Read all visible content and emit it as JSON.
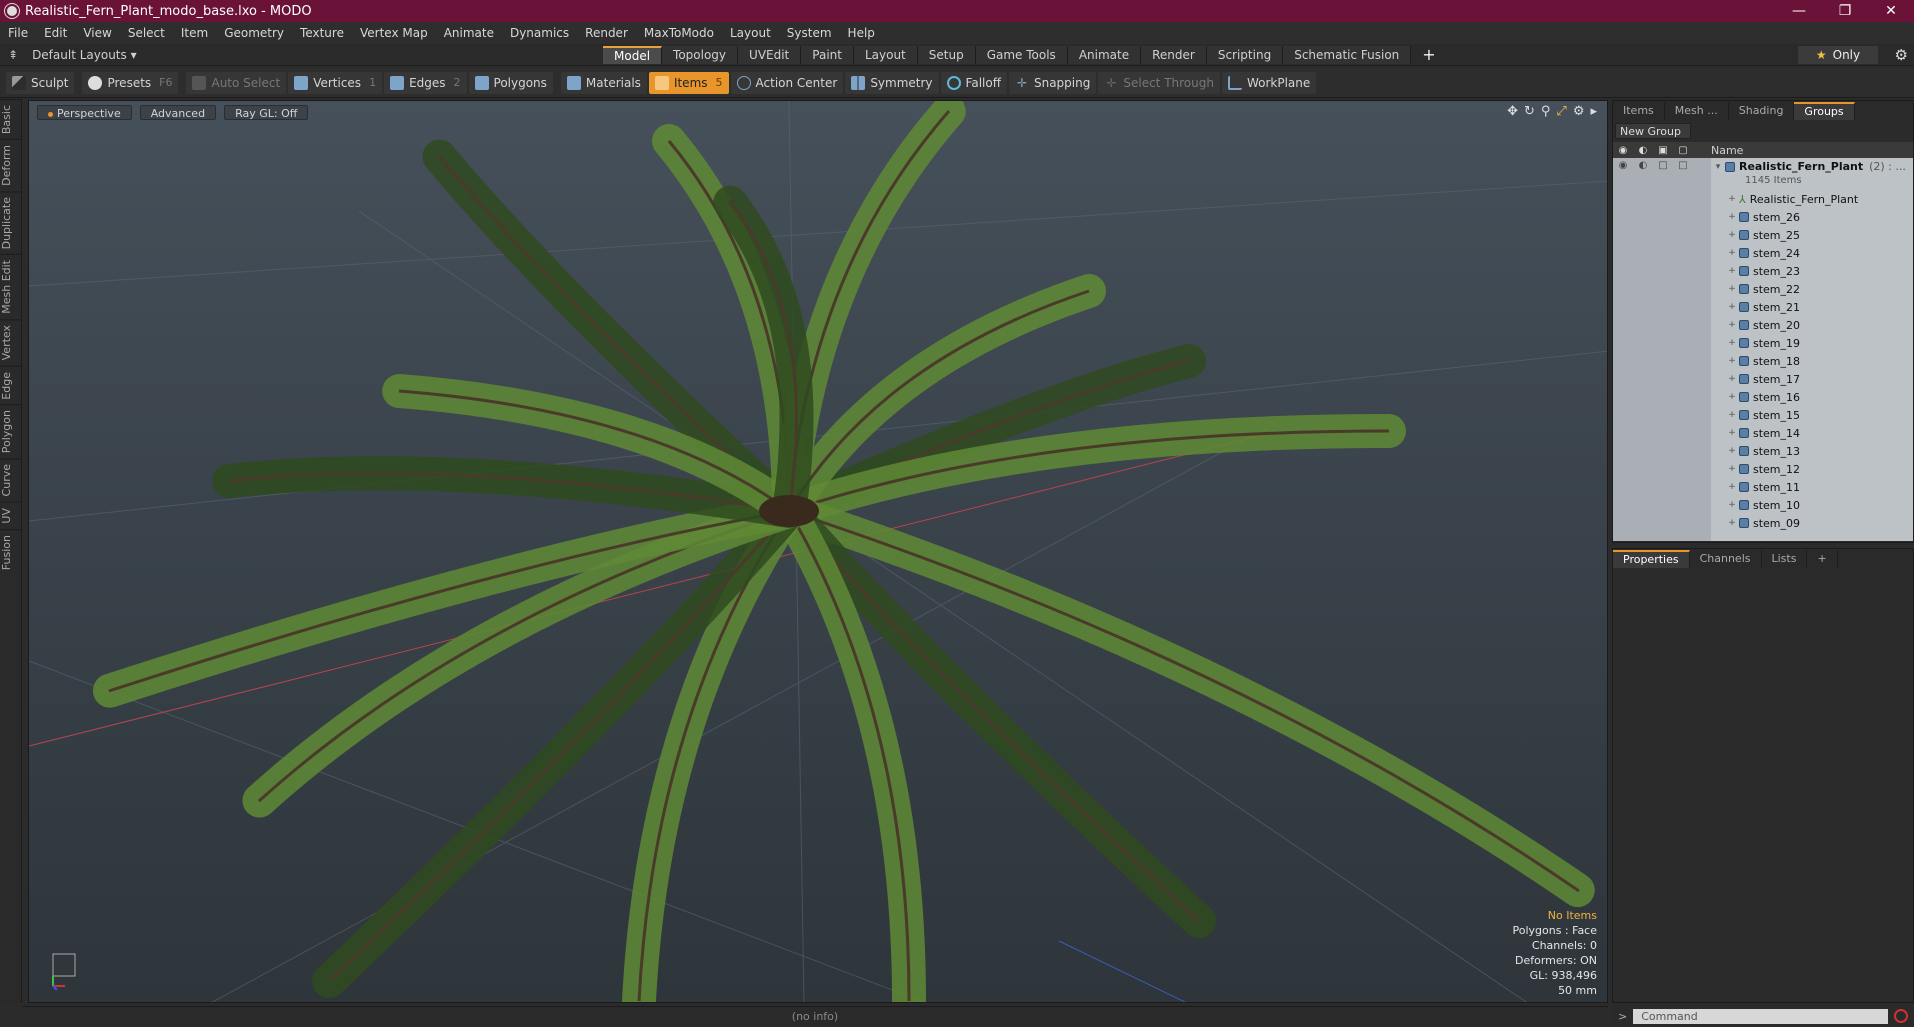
{
  "window": {
    "title": "Realistic_Fern_Plant_modo_base.lxo - MODO",
    "minimize": "—",
    "maximize": "❐",
    "close": "✕"
  },
  "menu": [
    "File",
    "Edit",
    "View",
    "Select",
    "Item",
    "Geometry",
    "Texture",
    "Vertex Map",
    "Animate",
    "Dynamics",
    "Render",
    "MaxToModo",
    "Layout",
    "System",
    "Help"
  ],
  "layout": {
    "selector": "Default Layouts ▾",
    "tabs": [
      "Model",
      "Topology",
      "UVEdit",
      "Paint",
      "Layout",
      "Setup",
      "Game Tools",
      "Animate",
      "Render",
      "Scripting",
      "Schematic Fusion"
    ],
    "active_tab": "Model",
    "only_label": "Only"
  },
  "toolbar": {
    "sculpt": "Sculpt",
    "presets": "Presets",
    "presets_key": "F6",
    "auto_select": "Auto Select",
    "vertices": "Vertices",
    "vertices_count": "1",
    "edges": "Edges",
    "edges_count": "2",
    "polygons": "Polygons",
    "materials": "Materials",
    "items": "Items",
    "items_count": "5",
    "action_center": "Action Center",
    "symmetry": "Symmetry",
    "falloff": "Falloff",
    "snapping": "Snapping",
    "select_through": "Select Through",
    "workplane": "WorkPlane"
  },
  "left_tabs": [
    "Basic",
    "Deform",
    "Duplicate",
    "Mesh Edit",
    "Vertex",
    "Edge",
    "Polygon",
    "Curve",
    "UV",
    "Fusion"
  ],
  "viewport": {
    "view_mode": "Perspective",
    "shading": "Advanced",
    "raygl": "Ray GL: Off",
    "info": {
      "no_items": "No Items",
      "polygons": "Polygons : Face",
      "channels": "Channels: 0",
      "deformers": "Deformers: ON",
      "gl": "GL: 938,496",
      "scale": "50 mm"
    }
  },
  "status": "(no info)",
  "right_panel": {
    "tabs": [
      "Items",
      "Mesh ...",
      "Shading",
      "Groups"
    ],
    "active_tab": "Groups",
    "new_group": "New Group",
    "name_col": "Name",
    "group": {
      "name": "Realistic_Fern_Plant",
      "count": "(2) : ...",
      "items": "1145 Items"
    },
    "children": [
      "Realistic_Fern_Plant",
      "stem_26",
      "stem_25",
      "stem_24",
      "stem_23",
      "stem_22",
      "stem_21",
      "stem_20",
      "stem_19",
      "stem_18",
      "stem_17",
      "stem_16",
      "stem_15",
      "stem_14",
      "stem_13",
      "stem_12",
      "stem_11",
      "stem_10",
      "stem_09"
    ]
  },
  "props_panel": {
    "tabs": [
      "Properties",
      "Channels",
      "Lists"
    ],
    "active_tab": "Properties"
  },
  "command": {
    "prompt": ">",
    "placeholder": "Command"
  },
  "colors": {
    "title_bar": "#6b1239",
    "accent": "#e8952b",
    "fern_dark": "#2f4a1e",
    "fern_light": "#5f8a35"
  }
}
